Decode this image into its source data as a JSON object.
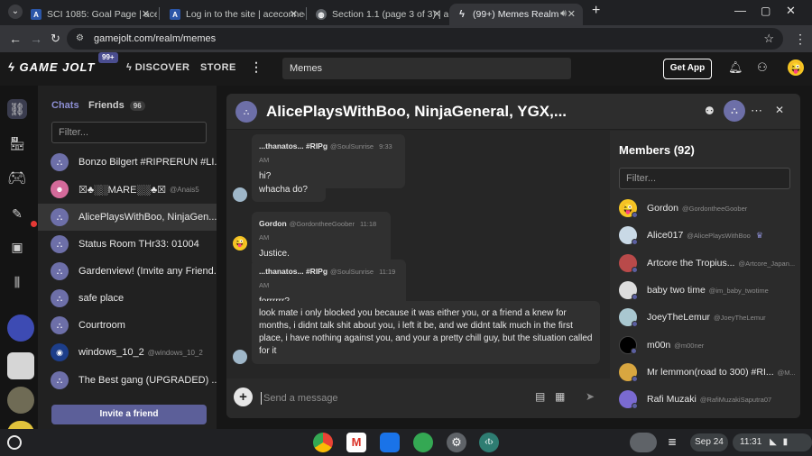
{
  "browser": {
    "tabs": [
      {
        "title": "SCI 1085: Goal Page | aceconn"
      },
      {
        "title": "Log in to the site | aceconnect"
      },
      {
        "title": "Section 1.1 (page 3 of 3) | acec"
      },
      {
        "title": "(99+) Memes Realm - Art, v"
      }
    ],
    "url": "gamejolt.com/realm/memes"
  },
  "gj": {
    "logo": "GAME JOLT",
    "logo_badge": "99+",
    "discover": "DISCOVER",
    "store": "STORE",
    "search_value": "Memes",
    "get_app": "Get App"
  },
  "chats": {
    "tab_chats": "Chats",
    "tab_friends": "Friends",
    "friends_count": "96",
    "filter_placeholder": "Filter...",
    "items": [
      {
        "name": "Bonzo Bilgert #RIPRERUN #LI...",
        "handle": ""
      },
      {
        "name": "☒♣░░MARE░░♣☒",
        "handle": "@Anais5"
      },
      {
        "name": "AlicePlaysWithBoo, NinjaGen...",
        "handle": ""
      },
      {
        "name": "Status Room THr33: 01004",
        "handle": ""
      },
      {
        "name": "Gardenview! (Invite any Friend...",
        "handle": ""
      },
      {
        "name": "safe place",
        "handle": ""
      },
      {
        "name": "Courtroom",
        "handle": ""
      },
      {
        "name": "windows_10_2",
        "handle": "@windows_10_2"
      },
      {
        "name": "The Best gang (UPGRADED) ...",
        "handle": ""
      }
    ],
    "invite": "Invite a friend"
  },
  "chat": {
    "title": "AlicePlaysWithBoo, NinjaGeneral, YGX,...",
    "messages": [
      {
        "name": "...thanatos... #RIPg",
        "handle": "@SoulSunrise",
        "time": "9:33 AM",
        "text": "hi?"
      },
      {
        "name": "",
        "handle": "",
        "time": "",
        "text": "whacha do?"
      },
      {
        "name": "Gordon",
        "handle": "@GordontheeGoober",
        "time": "11:18 AM",
        "text": "Justice."
      },
      {
        "name": "...thanatos... #RIPg",
        "handle": "@SoulSunrise",
        "time": "11:19 AM",
        "text": "forrrrrr?"
      },
      {
        "name": "",
        "handle": "",
        "time": "",
        "text": "look mate i only blocked you because it was either you, or a friend a knew for months, i didnt talk shit about you, i left it be, and we didnt talk much in the first place, i have nothing against you, and your a pretty chill guy, but the situation called for it"
      }
    ],
    "send_placeholder": "Send a message"
  },
  "members": {
    "title": "Members (92)",
    "filter_placeholder": "Filter...",
    "list": [
      {
        "name": "Gordon",
        "handle": "@GordontheeGoober"
      },
      {
        "name": "Alice017",
        "handle": "@AlicePlaysWithBoo"
      },
      {
        "name": "Artcore the Tropius...",
        "handle": "@Artcore_Japan..."
      },
      {
        "name": "baby two time",
        "handle": "@im_baby_twotime"
      },
      {
        "name": "JoeyTheLemur",
        "handle": "@JoeyTheLemur"
      },
      {
        "name": "m00n",
        "handle": "@m00ner"
      },
      {
        "name": "Mr lemmon(road to 300) #RI...",
        "handle": "@M..."
      },
      {
        "name": "Rafi Muzaki",
        "handle": "@RafiMuzakiSaputra07"
      }
    ]
  },
  "taskbar": {
    "date": "Sep 24",
    "time": "11:31"
  },
  "colors": {
    "accent": "#5c5f99",
    "background": "#1b1b1b"
  }
}
